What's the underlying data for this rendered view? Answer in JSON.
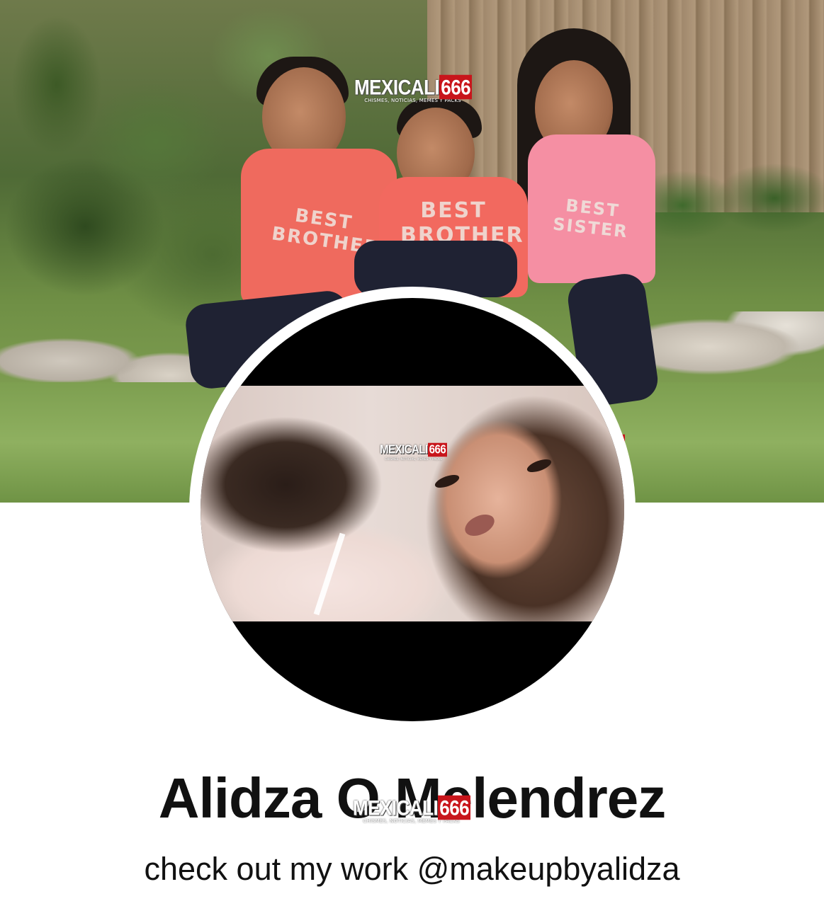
{
  "profile": {
    "name": "Alidza O Melendrez",
    "bio": "check out my work @makeupbyalidza"
  },
  "watermark": {
    "word": "MEXICALI",
    "number": "666",
    "tagline": "CHISMES, NOTICIAS, MEMES Y PACKS"
  },
  "cover_photo": {
    "shirt_text_left": "BEST BROTHER",
    "shirt_text_middle": "BEST BROTHER",
    "shirt_text_right": "BEST SISTER"
  },
  "colors": {
    "background": "#ffffff",
    "text": "#111111",
    "watermark_red": "#c8151b",
    "avatar_ring": "#ffffff"
  }
}
